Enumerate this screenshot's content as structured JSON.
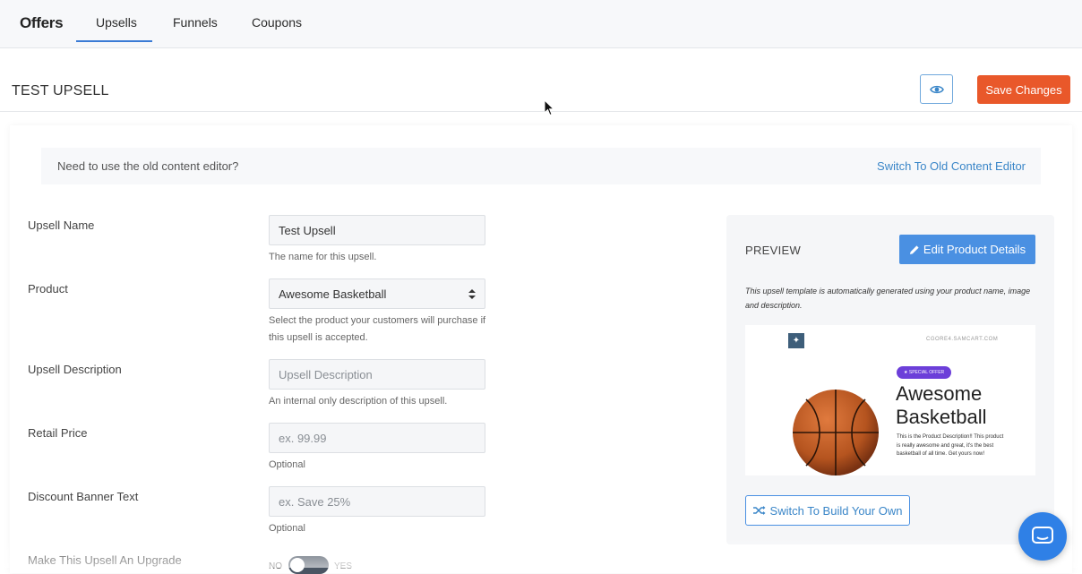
{
  "nav": {
    "brand": "Offers",
    "tabs": [
      {
        "label": "Upsells",
        "active": true
      },
      {
        "label": "Funnels",
        "active": false
      },
      {
        "label": "Coupons",
        "active": false
      }
    ]
  },
  "header": {
    "title": "TEST UPSELL",
    "preview_icon": "eye-icon",
    "save_label": "Save Changes"
  },
  "notice": {
    "text": "Need to use the old content editor?",
    "link": "Switch To Old Content Editor"
  },
  "form": {
    "upsell_name": {
      "label": "Upsell Name",
      "value": "Test Upsell",
      "help": "The name for this upsell."
    },
    "product": {
      "label": "Product",
      "value": "Awesome Basketball",
      "help": "Select the product your customers will purchase if this upsell is accepted."
    },
    "description": {
      "label": "Upsell Description",
      "placeholder": "Upsell Description",
      "help": "An internal only description of this upsell."
    },
    "retail_price": {
      "label": "Retail Price",
      "placeholder": "ex. 99.99",
      "help": "Optional"
    },
    "discount_banner": {
      "label": "Discount Banner Text",
      "placeholder": "ex. Save 25%",
      "help": "Optional"
    },
    "upgrade": {
      "label": "Make This Upsell An Upgrade",
      "no": "NO",
      "yes": "YES",
      "enabled": false
    }
  },
  "preview": {
    "title": "PREVIEW",
    "edit_label": "Edit Product Details",
    "note": "This upsell template is automatically generated using your product name, image and description.",
    "thumb": {
      "url": "CGORE4.SAMCART.COM",
      "badge": "★ SPECIAL OFFER",
      "product_title": "Awesome Basketball",
      "product_desc": "This is the Product Description!! This product is really awesome and great, it's the best basketball of all time. Get yours now!"
    },
    "switch_label": "Switch To Build Your Own"
  },
  "colors": {
    "accent": "#4a90e2",
    "save": "#e9582a",
    "chat": "#2f80e6"
  }
}
